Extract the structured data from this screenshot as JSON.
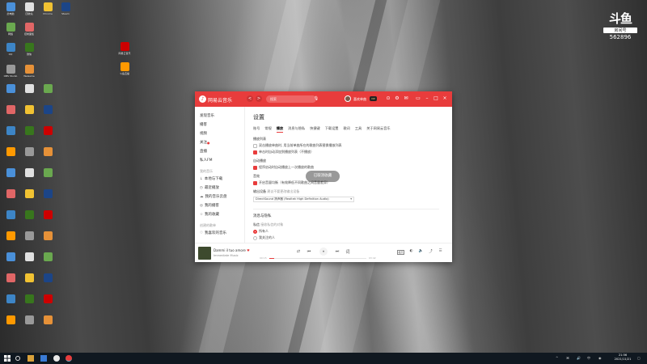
{
  "app": {
    "name": "网易云音乐",
    "search_placeholder": "搜索",
    "username": "喜欢单曲",
    "vip": "VIP",
    "nav_back": "<",
    "nav_forward": ">"
  },
  "sidebar": {
    "items": [
      {
        "label": "发现音乐"
      },
      {
        "label": "播客"
      },
      {
        "label": "视频"
      },
      {
        "label": "关注"
      },
      {
        "label": "直播"
      },
      {
        "label": "私人FM"
      }
    ],
    "my_music_title": "我的音乐",
    "my_music": [
      {
        "icon": "↓",
        "label": "本地与下载"
      },
      {
        "icon": "◷",
        "label": "最近播放"
      },
      {
        "icon": "☁",
        "label": "我的音乐云盘"
      },
      {
        "icon": "◎",
        "label": "我的播客"
      },
      {
        "icon": "☆",
        "label": "我的收藏"
      }
    ],
    "playlist_title": "创建的歌单",
    "playlists": [
      {
        "icon": "♡",
        "label": "我喜欢的音乐"
      }
    ]
  },
  "settings": {
    "title": "设置",
    "tabs": [
      "账号",
      "常规",
      "播放",
      "消息与隐私",
      "快捷键",
      "下载设置",
      "歌词",
      "工具",
      "关于网易云音乐"
    ],
    "active_tab": "播放",
    "play_list_label": "播放列表",
    "play_list_options": [
      {
        "label": "双击播放单曲时, 用当前单曲所在的歌曲列表替换播放列表",
        "checked": false
      },
      {
        "label": "单击时自动添加到播放列表（不播放）",
        "checked": true
      }
    ],
    "auto_play_label": "自动播放",
    "auto_play_options": [
      {
        "label": "程序启动时自动播放上一次播放的歌曲",
        "checked": true
      }
    ],
    "effect_label": "音效",
    "effect_options": [
      {
        "label": "开启音量均衡（有效降低不同歌曲之间音量差异）",
        "checked": true
      }
    ],
    "output_label": "输出设备",
    "output_hint": "建议不要更改输出设备",
    "output_device": "DirectSound 扬声器 (Realtek High Definition Audio)",
    "privacy_title": "消息与隐私",
    "private_msg_label": "私信",
    "private_msg_hint": "接收私信的对象",
    "privacy_options": [
      {
        "label": "所有人",
        "selected": true
      },
      {
        "label": "我关注的人",
        "selected": false
      }
    ]
  },
  "toast": "已取消收藏",
  "player": {
    "song": "Dammi il tuo amore",
    "artist": "Immediate Music",
    "current_time": "00:15",
    "total_time": "03:42",
    "progress": 0.05,
    "prev_icon": "⏮",
    "play_icon": "⏸",
    "next_icon": "⏭",
    "quality_label": "极高",
    "controls": [
      "♡",
      "↓",
      "⋯"
    ]
  },
  "desktop_icons": [
    {
      "label": "此电脑"
    },
    {
      "label": "回收站"
    },
    {
      "label": "网络"
    },
    {
      "label": "控制面板"
    },
    {
      "label": "Chrome"
    },
    {
      "label": "Steam"
    },
    {
      "label": "QQ"
    },
    {
      "label": "微信"
    },
    {
      "label": "网易云音乐"
    },
    {
      "label": "斗鱼直播"
    },
    {
      "label": "OBS Studio"
    },
    {
      "label": "WeGame"
    }
  ],
  "watermark": {
    "logo": "斗鱼",
    "room_label": "房间号",
    "room_number": "562896"
  },
  "taskbar": {
    "time": "21:56",
    "date": "2021/11/21"
  },
  "colors": {
    "accent": "#e83c3c",
    "taskbar": "#101820"
  }
}
